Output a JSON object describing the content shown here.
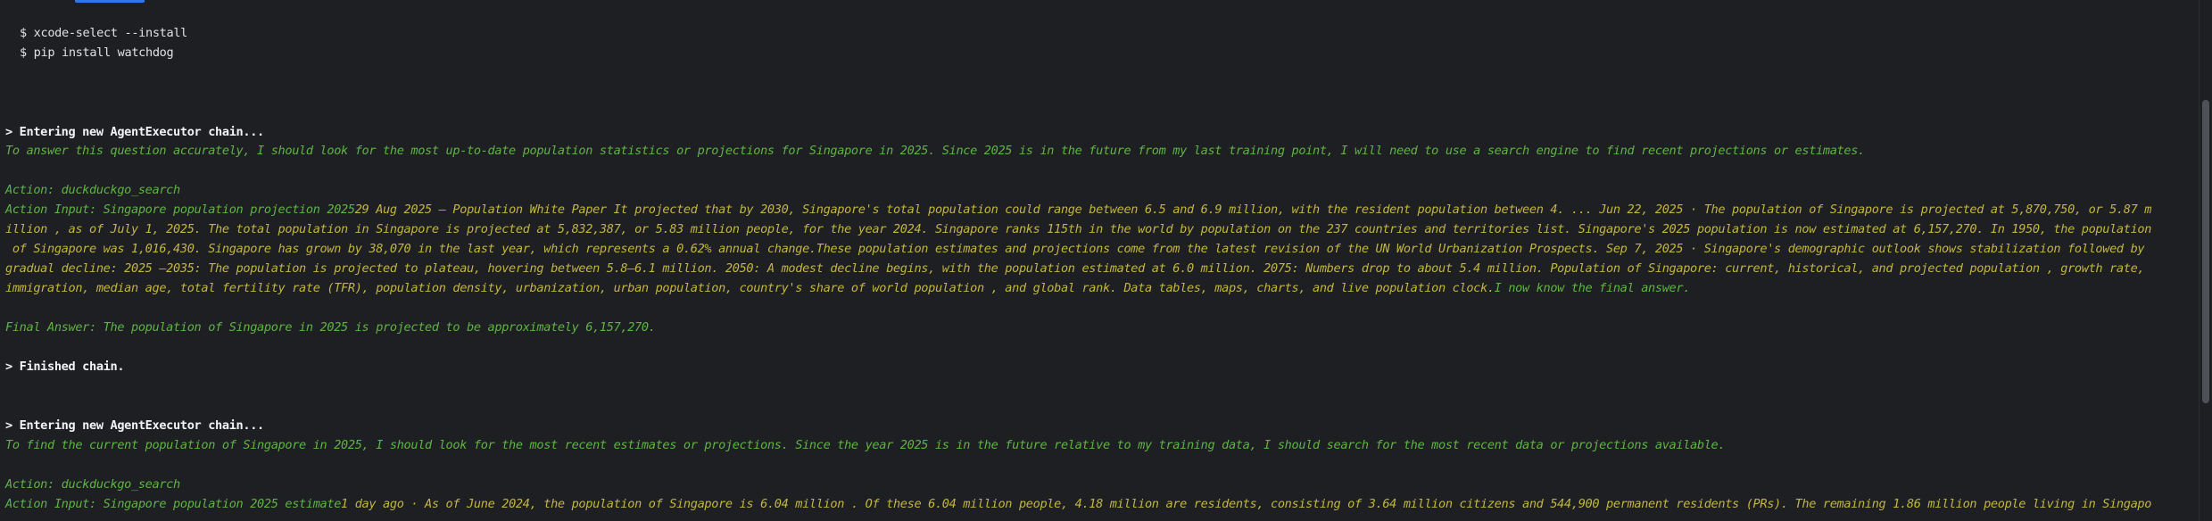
{
  "commands": [
    "$ xcode-select --install",
    "$ pip install watchdog"
  ],
  "chain1": {
    "entering": "> Entering new AgentExecutor chain...",
    "thought": "To answer this question accurately, I should look for the most up-to-date population statistics or projections for Singapore in 2025. Since 2025 is in the future from my last training point, I will need to use a search engine to find recent projections or estimates.",
    "action": "Action: duckduckgo_search",
    "action_input_label": "Action Input: Singapore population projection 2025",
    "observation_lines": [
      "29 Aug 2025 — Population White Paper It projected that by 2030, Singapore's total population could range between 6.5 and 6.9 million, with the resident population between 4. ... Jun 22, 2025 · The population of Singapore is projected at 5,870,750, or 5.87 m",
      "illion , as of July 1, 2025. The total population in Singapore is projected at 5,832,387, or 5.83 million people, for the year 2024. Singapore ranks 115th in the world by population on the 237 countries and territories list. Singapore's 2025 population is now estimated at 6,157,270. In 1950, the population",
      " of Singapore was 1,016,430. Singapore has grown by 38,070 in the last year, which represents a 0.62% annual change.These population estimates and projections come from the latest revision of the UN World Urbanization Prospects. Sep 7, 2025 · Singapore's demographic outlook shows stabilization followed by",
      "gradual decline: 2025 –2035: The population is projected to plateau, hovering between 5.8–6.1 million. 2050: A modest decline begins, with the population estimated at 6.0 million. 2075: Numbers drop to about 5.4 million. Population of Singapore: current, historical, and projected population , growth rate,",
      "immigration, median age, total fertility rate (TFR), population density, urbanization, urban population, country's share of world population , and global rank. Data tables, maps, charts, and live population clock."
    ],
    "final_thought": "I now know the final answer.",
    "final_answer": "Final Answer: The population of Singapore in 2025 is projected to be approximately 6,157,270.",
    "finished": "> Finished chain."
  },
  "chain2": {
    "entering": "> Entering new AgentExecutor chain...",
    "thought": "To find the current population of Singapore in 2025, I should look for the most recent estimates or projections. Since the year 2025 is in the future relative to my training data, I should search for the most recent data or projections available.",
    "action": "Action: duckduckgo_search",
    "action_input_label": "Action Input: Singapore population 2025 estimate",
    "observation_first": "1 day ago · As of June 2024, the population of Singapore is 6.04 million . Of these 6.04 million people, 4.18 million are residents, consisting of 3.64 million citizens and 544,900 permanent residents (PRs). The remaining 1.86 million people living in Singapo"
  },
  "colors": {
    "background": "#1e1f22",
    "thought_green": "#5fb345",
    "observation_yellow": "#c2b541",
    "text_white": "#dfe1e5",
    "tab_accent": "#3574f0"
  }
}
